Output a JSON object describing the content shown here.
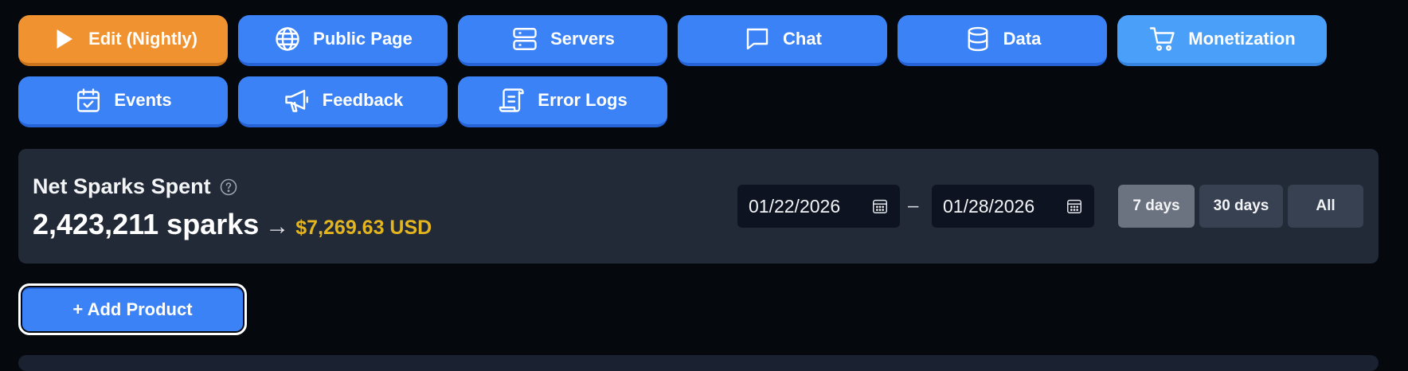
{
  "nav": {
    "edit": "Edit (Nightly)",
    "public_page": "Public Page",
    "servers": "Servers",
    "chat": "Chat",
    "data": "Data",
    "monetization": "Monetization",
    "events": "Events",
    "feedback": "Feedback",
    "error_logs": "Error Logs"
  },
  "metric": {
    "title": "Net Sparks Spent",
    "sparks": "2,423,211 sparks",
    "arrow": "→",
    "usd": "$7,269.63 USD"
  },
  "date_range": {
    "start": "01/22/2026",
    "separator": "–",
    "end": "01/28/2026"
  },
  "ranges": {
    "seven": "7 days",
    "thirty": "30 days",
    "all": "All",
    "selected": "7 days"
  },
  "actions": {
    "add_product": "+ Add Product"
  },
  "colors": {
    "accent": "#3b82f6",
    "edit": "#f0922f",
    "monetization": "#4a9ff8",
    "usd": "#e3b51f",
    "background": "#05080d",
    "panel": "#222a38"
  },
  "icons": {
    "edit": "play-icon",
    "public_page": "globe-icon",
    "servers": "server-icon",
    "chat": "chat-bubble-icon",
    "data": "database-icon",
    "monetization": "cart-icon",
    "events": "calendar-check-icon",
    "feedback": "megaphone-icon",
    "error_logs": "scroll-icon",
    "help": "question-circle-icon",
    "date": "calendar-icon"
  }
}
